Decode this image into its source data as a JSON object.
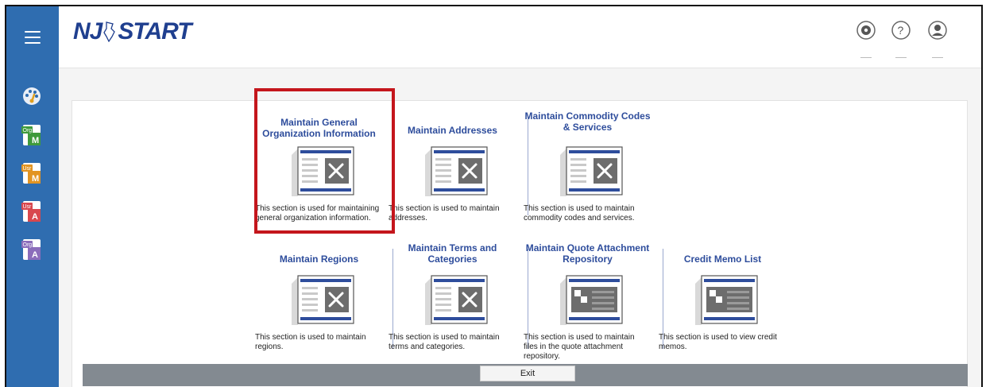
{
  "app": {
    "logo_text_1": "NJ",
    "logo_text_2": "START"
  },
  "sidebar": {
    "items": [
      {
        "icon": "dashboard-icon",
        "badge": ""
      },
      {
        "icon": "org-maintain-icon",
        "badge": "Org",
        "letter": "M",
        "color": "#3f9a3c"
      },
      {
        "icon": "user-maintain-icon",
        "badge": "Usr",
        "letter": "M",
        "color": "#e29422"
      },
      {
        "icon": "user-admin-icon",
        "badge": "Usr",
        "letter": "A",
        "color": "#d8484f"
      },
      {
        "icon": "org-admin-icon",
        "badge": "Org",
        "letter": "A",
        "color": "#8b6dbb"
      }
    ]
  },
  "header": {
    "icons": [
      "settings-icon",
      "help-icon",
      "user-profile-icon"
    ]
  },
  "tiles": [
    {
      "title": "Maintain General Organization Information",
      "desc": "This section is used for maintaining general organization information.",
      "illus": "tools"
    },
    {
      "title": "Maintain Addresses",
      "desc": "This section is used to maintain addresses.",
      "illus": "tools"
    },
    {
      "title": "Maintain Commodity Codes & Services",
      "desc": "This section is used to maintain commodity codes and services.",
      "illus": "tools"
    },
    {
      "title": "Maintain Regions",
      "desc": "This section is used to maintain regions.",
      "illus": "tools"
    },
    {
      "title": "Maintain Terms and Categories",
      "desc": "This section is used to maintain terms and categories.",
      "illus": "tools"
    },
    {
      "title": "Maintain Quote Attachment Repository",
      "desc": "This section is used to maintain files in the quote attachment repository.",
      "illus": "list"
    },
    {
      "title": "Credit Memo List",
      "desc": "This section is used to view credit memos.",
      "illus": "list"
    }
  ],
  "footer": {
    "exit_label": "Exit"
  },
  "colors": {
    "accent": "#2f6db0",
    "title": "#2e4d9c",
    "highlight": "#c4161c",
    "footer_bar": "#838a91"
  }
}
